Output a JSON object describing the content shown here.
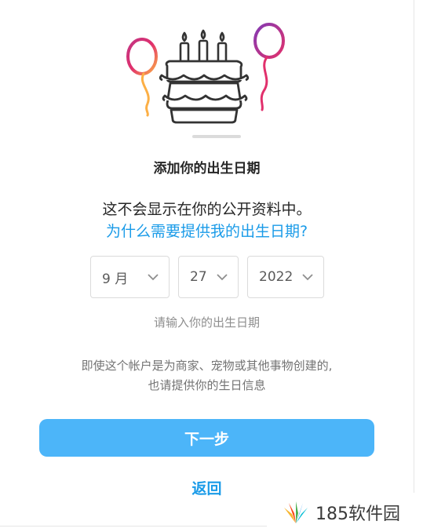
{
  "dialog": {
    "title": "添加你的出生日期",
    "info": "这不会显示在你的公开资料中。",
    "why_link": "为什么需要提供我的出生日期?",
    "month": {
      "selected": "9 月"
    },
    "day": {
      "selected": "27"
    },
    "year": {
      "selected": "2022"
    },
    "hint": "请输入你的出生日期",
    "note_line1": "即使这个帐户是为商家、宠物或其他事物创建的,",
    "note_line2": "也请提供你的生日信息",
    "next_label": "下一步",
    "back_label": "返回"
  },
  "watermark": {
    "text": "185软件园"
  },
  "colors": {
    "accent": "#1a9be8",
    "button": "#4cb5f9",
    "text": "#262626",
    "muted": "#8e8e8e"
  },
  "icons": {
    "illustration": "birthday-cake-balloons",
    "chevron": "chevron-down-icon",
    "logo": "fan-logo"
  }
}
